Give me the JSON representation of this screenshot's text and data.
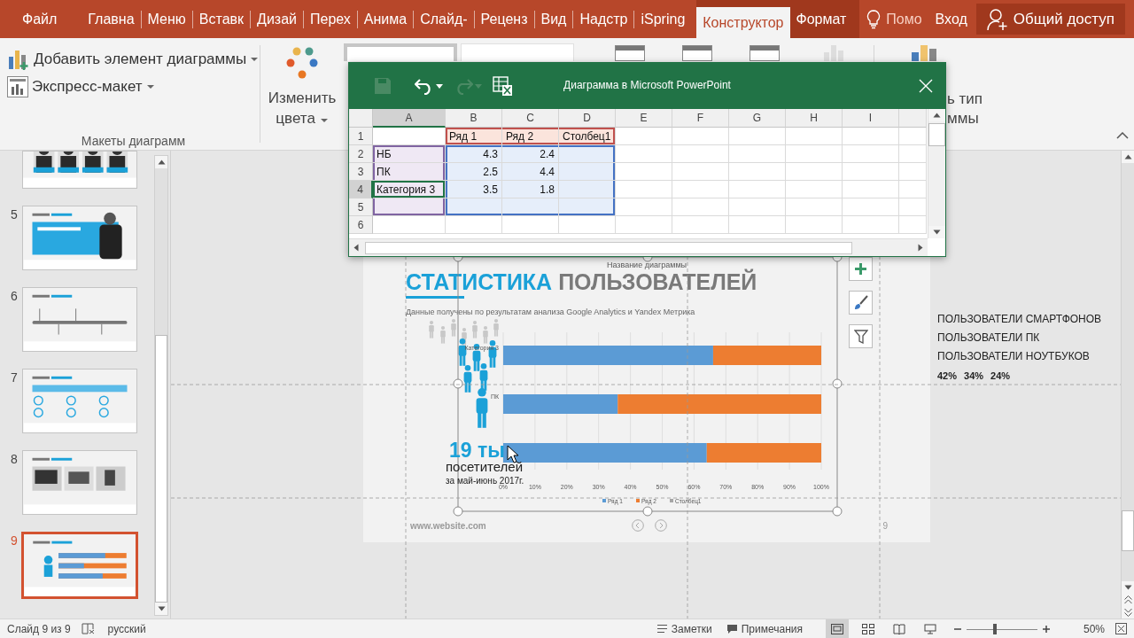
{
  "tabs": [
    {
      "label": "Файл",
      "kind": "file",
      "selected": false
    },
    {
      "label": "Главна",
      "kind": "normal",
      "selected": false
    },
    {
      "label": "Меню",
      "kind": "normal",
      "selected": false
    },
    {
      "label": "Вставк",
      "kind": "normal",
      "selected": false
    },
    {
      "label": "Дизай",
      "kind": "normal",
      "selected": false
    },
    {
      "label": "Перех",
      "kind": "normal",
      "selected": false
    },
    {
      "label": "Анима",
      "kind": "normal",
      "selected": false
    },
    {
      "label": "Слайд-",
      "kind": "normal",
      "selected": false
    },
    {
      "label": "Реценз",
      "kind": "normal",
      "selected": false
    },
    {
      "label": "Вид",
      "kind": "normal",
      "selected": false
    },
    {
      "label": "Надстр",
      "kind": "normal",
      "selected": false
    },
    {
      "label": "iSpring",
      "kind": "normal",
      "selected": false
    },
    {
      "label": "Конструктор",
      "kind": "contextual",
      "selected": true
    },
    {
      "label": "Формат",
      "kind": "contextual",
      "selected": false
    }
  ],
  "tell_me": "Помо",
  "sign_in": "Вход",
  "share": "Общий доступ",
  "ribbon": {
    "add_element": "Добавить элемент диаграммы",
    "quick_layout": "Экспресс-макет",
    "group_label": "Макеты диаграмм",
    "change_colors": [
      "Изменить",
      "цвета"
    ],
    "change_type": [
      "ь тип",
      "ммы"
    ]
  },
  "excel": {
    "title": "Диаграмма в Microsoft PowerPoint",
    "columns": [
      {
        "label": "A",
        "selected": true
      },
      {
        "label": "B",
        "selected": false
      },
      {
        "label": "C",
        "selected": false
      },
      {
        "label": "D",
        "selected": false
      },
      {
        "label": "E",
        "selected": false
      },
      {
        "label": "F",
        "selected": false
      },
      {
        "label": "G",
        "selected": false
      },
      {
        "label": "H",
        "selected": false
      },
      {
        "label": "I",
        "selected": false
      }
    ],
    "rows": [
      {
        "number": "1",
        "selected": false,
        "cells": [
          null,
          {
            "text": "Ряд 1",
            "kind": "header"
          },
          {
            "text": "Ряд 2",
            "kind": "header"
          },
          {
            "text": "Столбец1",
            "kind": "header"
          }
        ]
      },
      {
        "number": "2",
        "selected": false,
        "cells": [
          {
            "text": "НБ",
            "kind": "category"
          },
          {
            "text": "4.3",
            "kind": "values"
          },
          {
            "text": "2.4",
            "kind": "values"
          },
          {
            "kind": "values"
          }
        ]
      },
      {
        "number": "3",
        "selected": false,
        "cells": [
          {
            "text": "ПК",
            "kind": "category"
          },
          {
            "text": "2.5",
            "kind": "values"
          },
          {
            "text": "4.4",
            "kind": "values"
          },
          {
            "kind": "values"
          }
        ]
      },
      {
        "number": "4",
        "selected": true,
        "cells": [
          {
            "text": "Категория 3",
            "kind": "category"
          },
          {
            "text": "3.5",
            "kind": "values"
          },
          {
            "text": "1.8",
            "kind": "values"
          },
          {
            "kind": "values"
          }
        ]
      },
      {
        "number": "5",
        "selected": false,
        "cells": [
          {
            "kind": "category"
          },
          {
            "kind": "values"
          },
          {
            "kind": "values"
          },
          {
            "kind": "values"
          }
        ]
      },
      {
        "number": "6",
        "selected": false
      }
    ]
  },
  "thumbnails": [
    {
      "kind": "team",
      "selected": false
    },
    {
      "number": "5",
      "kind": "mission",
      "selected": false
    },
    {
      "number": "6",
      "kind": "history",
      "selected": false
    },
    {
      "number": "7",
      "kind": "service",
      "selected": false
    },
    {
      "number": "8",
      "kind": "portfolio",
      "selected": false
    },
    {
      "number": "9",
      "kind": "stats",
      "selected": true
    }
  ],
  "slide": {
    "title_accent": "СТАТИСТИКА",
    "title_rest": "ПОЛЬЗОВАТЕЛЕЙ",
    "subtitle": "Данные получены по результатам анализа Google Analytics и Yandex Метрика",
    "big_number": "19 ты",
    "caption": "посетителей",
    "period": "за май-июнь 2017г.",
    "footer": "www.website.com",
    "page": "9",
    "chart": {
      "chart_data": {
        "type": "bar",
        "orientation": "horizontal",
        "stacked": true,
        "title": "Название диаграммы",
        "categories": [
          "Категория 3",
          "ПК",
          null
        ],
        "series": [
          {
            "name": "Ряд 1",
            "color": "#5b9bd5",
            "values": [
              0.66,
              0.36,
              0.64
            ]
          },
          {
            "name": "Ряд 2",
            "color": "#ed7d31",
            "values": [
              0.34,
              0.64,
              0.36
            ]
          },
          {
            "name": "Столбец1",
            "color": "#a5a5a5",
            "values": [
              null,
              null,
              null
            ]
          }
        ],
        "xlim": [
          0,
          1
        ],
        "grid": true,
        "legend": true,
        "xticks": [
          {
            "value": 0,
            "label": "0%"
          },
          {
            "value": 0.1,
            "label": "10%"
          },
          {
            "value": 0.2,
            "label": "20%"
          },
          {
            "value": 0.3,
            "label": "30%"
          },
          {
            "value": 0.4,
            "label": "40%"
          },
          {
            "value": 0.5,
            "label": "50%"
          },
          {
            "value": 0.6,
            "label": "60%"
          },
          {
            "value": 0.7,
            "label": "70%"
          },
          {
            "value": 0.8,
            "label": "80%"
          },
          {
            "value": 0.9,
            "label": "90%"
          },
          {
            "value": 1,
            "label": "100%"
          }
        ]
      }
    }
  },
  "side_notes": [
    "ПОЛЬЗОВАТЕЛИ СМАРТФОНОВ",
    "ПОЛЬЗОВАТЕЛИ ПК",
    "ПОЛЬЗОВАТЕЛИ НОУТБУКОВ"
  ],
  "side_percents": [
    "42%",
    "34%",
    "24%"
  ],
  "status_bar": {
    "slide_label": "Слайд 9 из 9",
    "language": "русский",
    "notes": "Заметки",
    "comments": "Примечания",
    "views": [
      {
        "kind": "normal",
        "selected": true
      },
      {
        "kind": "sorter",
        "selected": false
      },
      {
        "kind": "reading",
        "selected": false
      },
      {
        "kind": "slideshow",
        "selected": false
      }
    ],
    "zoom_slider": {
      "level": 0.4
    },
    "zoom": "50%"
  }
}
